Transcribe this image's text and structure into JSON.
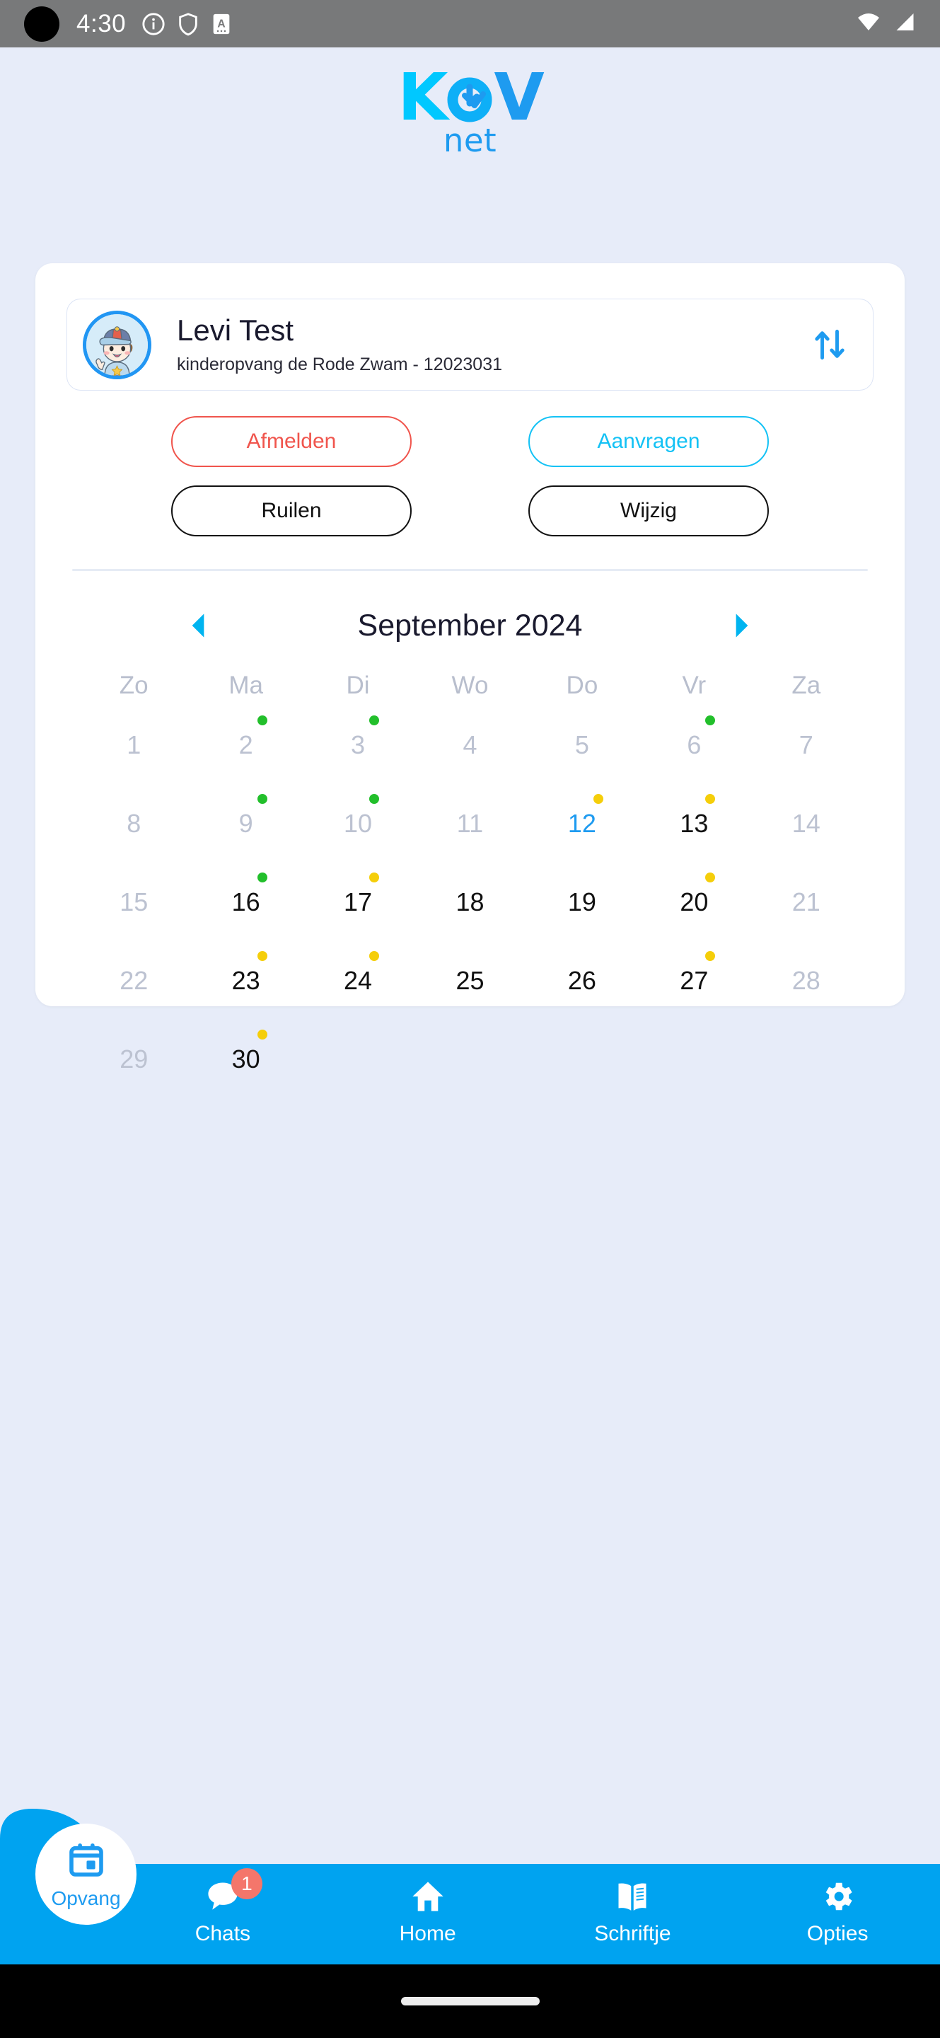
{
  "status_bar": {
    "time": "4:30",
    "icons": [
      "info-icon",
      "shield-icon",
      "a-letter-icon"
    ],
    "right_icons": [
      "wifi-icon",
      "signal-icon"
    ]
  },
  "logo": {
    "primary": "K",
    "mark": "O",
    "secondary": "V",
    "tagline": "net",
    "colors": {
      "light": "#00C8FF",
      "dark": "#1E9BF0"
    }
  },
  "profile": {
    "name": "Levi Test",
    "subtitle": "kinderopvang de Rode Zwam - 12023031",
    "avatar_name": "child-avatar",
    "swap_icon": "swap-vertical-icon"
  },
  "actions": {
    "afmelden": "Afmelden",
    "aanvragen": "Aanvragen",
    "ruilen": "Ruilen",
    "wijzig": "Wijzig",
    "colors": {
      "afmelden": "#F0554D",
      "aanvragen": "#14C2F5",
      "neutral": "#111111"
    }
  },
  "calendar": {
    "title": "September 2024",
    "prev_label": "◀",
    "next_label": "▶",
    "weekdays": [
      "Zo",
      "Ma",
      "Di",
      "Wo",
      "Do",
      "Vr",
      "Za"
    ],
    "dot_colors": {
      "green": "#22BF2B",
      "yellow": "#F5CE0A"
    },
    "weeks": [
      [
        {
          "num": "1",
          "state": "muted",
          "dot": null
        },
        {
          "num": "2",
          "state": "muted",
          "dot": "green"
        },
        {
          "num": "3",
          "state": "muted",
          "dot": "green"
        },
        {
          "num": "4",
          "state": "muted",
          "dot": null
        },
        {
          "num": "5",
          "state": "muted",
          "dot": null
        },
        {
          "num": "6",
          "state": "muted",
          "dot": "green"
        },
        {
          "num": "7",
          "state": "muted",
          "dot": null
        }
      ],
      [
        {
          "num": "8",
          "state": "muted",
          "dot": null
        },
        {
          "num": "9",
          "state": "muted",
          "dot": "green"
        },
        {
          "num": "10",
          "state": "muted",
          "dot": "green"
        },
        {
          "num": "11",
          "state": "muted",
          "dot": null
        },
        {
          "num": "12",
          "state": "today",
          "dot": "yellow"
        },
        {
          "num": "13",
          "state": "active",
          "dot": "yellow"
        },
        {
          "num": "14",
          "state": "muted",
          "dot": null
        }
      ],
      [
        {
          "num": "15",
          "state": "muted",
          "dot": null
        },
        {
          "num": "16",
          "state": "active",
          "dot": "green"
        },
        {
          "num": "17",
          "state": "active",
          "dot": "yellow"
        },
        {
          "num": "18",
          "state": "active",
          "dot": null
        },
        {
          "num": "19",
          "state": "active",
          "dot": null
        },
        {
          "num": "20",
          "state": "active",
          "dot": "yellow"
        },
        {
          "num": "21",
          "state": "muted",
          "dot": null
        }
      ],
      [
        {
          "num": "22",
          "state": "muted",
          "dot": null
        },
        {
          "num": "23",
          "state": "active",
          "dot": "yellow"
        },
        {
          "num": "24",
          "state": "active",
          "dot": "yellow"
        },
        {
          "num": "25",
          "state": "active",
          "dot": null
        },
        {
          "num": "26",
          "state": "active",
          "dot": null
        },
        {
          "num": "27",
          "state": "active",
          "dot": "yellow"
        },
        {
          "num": "28",
          "state": "muted",
          "dot": null
        }
      ],
      [
        {
          "num": "29",
          "state": "muted",
          "dot": null
        },
        {
          "num": "30",
          "state": "active",
          "dot": "yellow"
        },
        {
          "num": "",
          "state": "empty",
          "dot": null
        },
        {
          "num": "",
          "state": "empty",
          "dot": null
        },
        {
          "num": "",
          "state": "empty",
          "dot": null
        },
        {
          "num": "",
          "state": "empty",
          "dot": null
        },
        {
          "num": "",
          "state": "empty",
          "dot": null
        }
      ]
    ]
  },
  "bottom_nav": {
    "fab": {
      "label": "Opvang",
      "icon": "calendar-day-icon"
    },
    "items": [
      {
        "label": "Chats",
        "icon": "chat-bubble-icon",
        "badge": "1"
      },
      {
        "label": "Home",
        "icon": "home-icon",
        "badge": null
      },
      {
        "label": "Schriftje",
        "icon": "book-icon",
        "badge": null
      },
      {
        "label": "Opties",
        "icon": "gear-icon",
        "badge": null
      }
    ],
    "background_color": "#00A3F0"
  }
}
